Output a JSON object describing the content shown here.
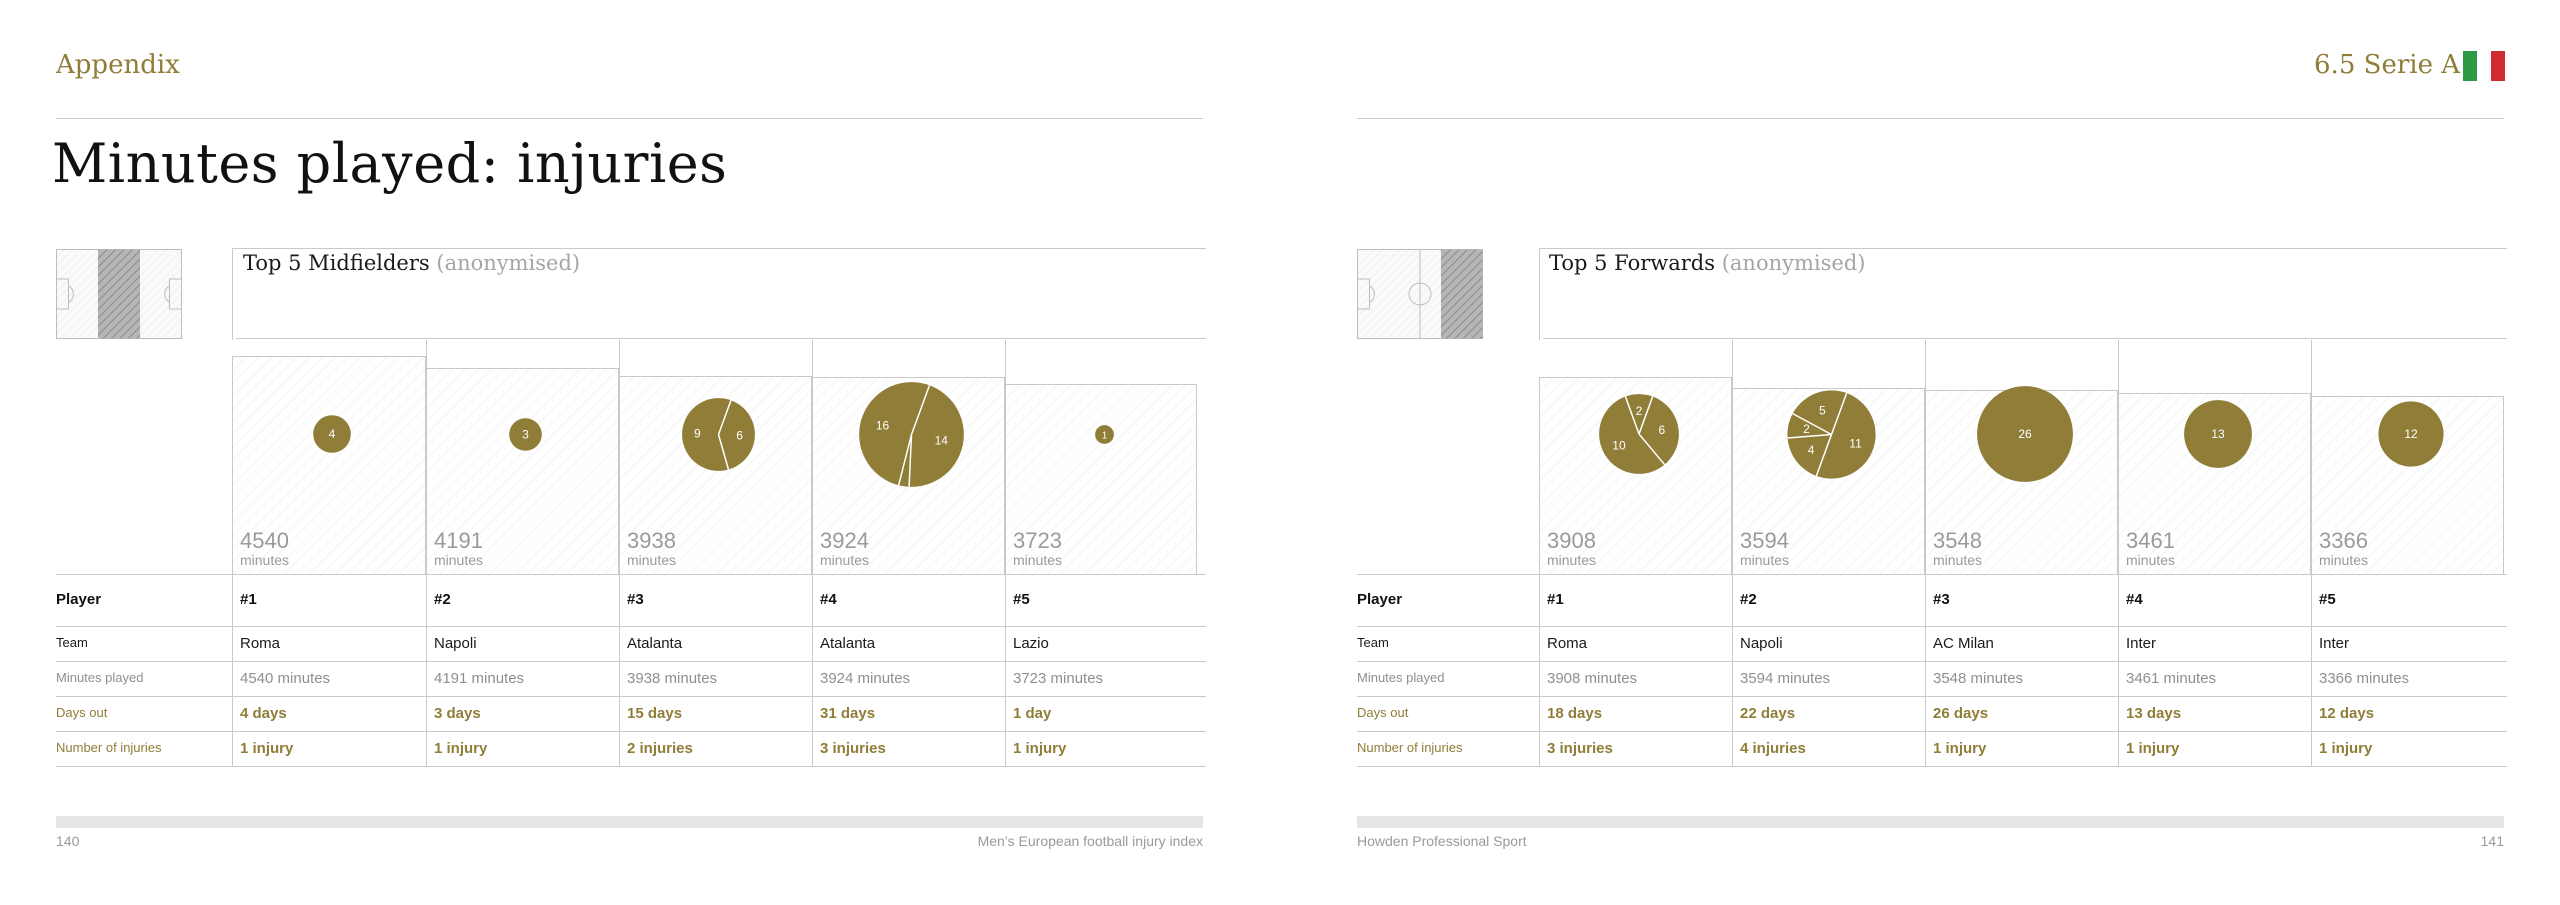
{
  "header": {
    "section": "Appendix",
    "chapter": "6.5 Serie A",
    "title": "Minutes played: injuries",
    "flag_colors": [
      "#2f9a46",
      "#ffffff",
      "#d12b32"
    ]
  },
  "colors": {
    "accent": "#8f7d38",
    "rule": "#c9c9c9",
    "muted": "#8f8f8f"
  },
  "row_labels": {
    "player": "Player",
    "team": "Team",
    "minutes": "Minutes played",
    "days": "Days out",
    "injuries": "Number of injuries"
  },
  "minutes_unit": "minutes",
  "chart_data": [
    {
      "type": "table",
      "title": "Top 5 Midfielders",
      "subtitle": "(anonymised)",
      "bar_scale": [
        3300,
        4540
      ],
      "players": [
        {
          "rank": "#1",
          "team": "Roma",
          "minutes": 4540,
          "minutes_text": "4540 minutes",
          "days": 4,
          "days_text": "4 days",
          "injuries": 1,
          "injuries_text": "1 injury",
          "injury_days": [
            4
          ]
        },
        {
          "rank": "#2",
          "team": "Napoli",
          "minutes": 4191,
          "minutes_text": "4191 minutes",
          "days": 3,
          "days_text": "3 days",
          "injuries": 1,
          "injuries_text": "1 injury",
          "injury_days": [
            3
          ]
        },
        {
          "rank": "#3",
          "team": "Atalanta",
          "minutes": 3938,
          "minutes_text": "3938 minutes",
          "days": 15,
          "days_text": "15 days",
          "injuries": 2,
          "injuries_text": "2 injuries",
          "injury_days": [
            6,
            9
          ]
        },
        {
          "rank": "#4",
          "team": "Atalanta",
          "minutes": 3924,
          "minutes_text": "3924 minutes",
          "days": 31,
          "days_text": "31 days",
          "injuries": 3,
          "injuries_text": "3 injuries",
          "injury_days": [
            14,
            1,
            16
          ]
        },
        {
          "rank": "#5",
          "team": "Lazio",
          "minutes": 3723,
          "minutes_text": "3723 minutes",
          "days": 1,
          "days_text": "1 day",
          "injuries": 1,
          "injuries_text": "1 injury",
          "injury_days": [
            1
          ]
        }
      ]
    },
    {
      "type": "table",
      "title": "Top 5 Forwards",
      "subtitle": "(anonymised)",
      "bar_scale": [
        3300,
        4540
      ],
      "players": [
        {
          "rank": "#1",
          "team": "Roma",
          "minutes": 3908,
          "minutes_text": "3908 minutes",
          "days": 18,
          "days_text": "18 days",
          "injuries": 3,
          "injuries_text": "3 injuries",
          "injury_days": [
            6,
            10,
            2
          ]
        },
        {
          "rank": "#2",
          "team": "Napoli",
          "minutes": 3594,
          "minutes_text": "3594 minutes",
          "days": 22,
          "days_text": "22 days",
          "injuries": 4,
          "injuries_text": "4 injuries",
          "injury_days": [
            11,
            4,
            2,
            5
          ]
        },
        {
          "rank": "#3",
          "team": "AC Milan",
          "minutes": 3548,
          "minutes_text": "3548 minutes",
          "days": 26,
          "days_text": "26 days",
          "injuries": 1,
          "injuries_text": "1 injury",
          "injury_days": [
            26
          ]
        },
        {
          "rank": "#4",
          "team": "Inter",
          "minutes": 3461,
          "minutes_text": "3461 minutes",
          "days": 13,
          "days_text": "13 days",
          "injuries": 1,
          "injuries_text": "1 injury",
          "injury_days": [
            13
          ]
        },
        {
          "rank": "#5",
          "team": "Inter",
          "minutes": 3366,
          "minutes_text": "3366 minutes",
          "days": 12,
          "days_text": "12 days",
          "injuries": 1,
          "injuries_text": "1 injury",
          "injury_days": [
            12
          ]
        }
      ]
    }
  ],
  "footer": {
    "left_page": "140",
    "left_text": "Men’s European football injury index",
    "right_text": "Howden Professional Sport",
    "right_page": "141"
  }
}
